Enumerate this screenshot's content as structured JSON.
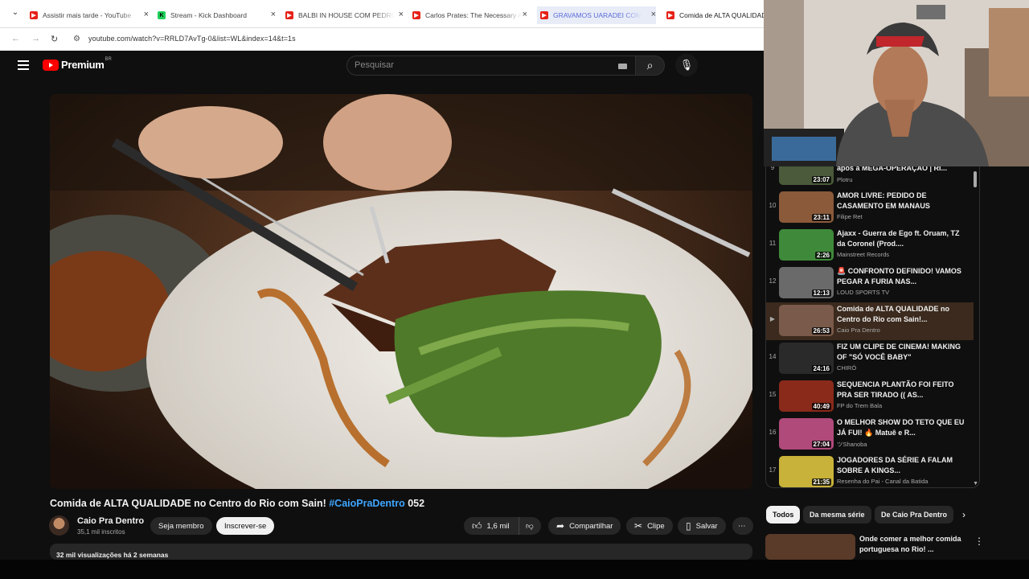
{
  "tabs": [
    {
      "title": "Assistir mais tarde - YouTube",
      "fav": "yt"
    },
    {
      "title": "Stream - Kick Dashboard",
      "fav": "kick"
    },
    {
      "title": "BALBI IN HOUSE COM PEDRO",
      "fav": "yt"
    },
    {
      "title": "Carlos Prates: The Necessary A",
      "fav": "yt"
    },
    {
      "title": "GRAVAMOS UARADEI COM OA",
      "fav": "yt"
    },
    {
      "title": "Comida de ALTA QUALIDADE",
      "fav": "yt"
    }
  ],
  "address": {
    "url": "youtube.com/watch?v=RRLD7AvTg-0&list=WL&index=14&t=1s"
  },
  "header": {
    "logo": "Premium",
    "logo_region": "BR",
    "search_placeholder": "Pesquisar"
  },
  "video": {
    "title": "Comida de ALTA QUALIDADE no Centro do Rio com Sain!",
    "hashtag": "#CaioPraDentro",
    "number": "052",
    "channel": "Caio Pra Dentro",
    "subs": "35,1 mil inscritos",
    "join": "Seja membro",
    "subscribe": "Inscrever-se",
    "likes": "1,6 mil",
    "share": "Compartilhar",
    "clip": "Clipe",
    "save": "Salvar",
    "views": "32 mil visualizações  há 2 semanas"
  },
  "playlist": [
    {
      "num": "9",
      "title": "após a MEGA-OPERAÇÃO | RI...",
      "channel": "Plotru",
      "dur": "23:07"
    },
    {
      "num": "10",
      "title": "AMOR LIVRE: PEDIDO DE CASAMENTO EM MANAUS",
      "channel": "Filipe Ret",
      "dur": "23:11"
    },
    {
      "num": "11",
      "title": "Ajaxx - Guerra de Ego ft. Oruam, TZ da Coronel (Prod....",
      "channel": "Mainstreet Records",
      "dur": "2:26"
    },
    {
      "num": "12",
      "title": "🚨 CONFRONTO DEFINIDO! VAMOS PEGAR A FURIA NAS...",
      "channel": "LOUD SPORTS TV",
      "dur": "12:13"
    },
    {
      "num": "▶",
      "title": "Comida de ALTA QUALIDADE no Centro do Rio com Sain!...",
      "channel": "Caio Pra Dentro",
      "dur": "26:53"
    },
    {
      "num": "14",
      "title": "FIZ UM CLIPE DE CINEMA! MAKING OF \"SÓ VOCÊ BABY\"",
      "channel": "CHIRÓ",
      "dur": "24:16"
    },
    {
      "num": "15",
      "title": "SEQUENCIA PLANTÃO FOI FEITO PRA SER TIRADO (( AS...",
      "channel": "FP do Trem Bala",
      "dur": "40:49"
    },
    {
      "num": "16",
      "title": "O MELHOR SHOW DO TETO QUE EU JÁ FUI! 🔥 Matuê e R...",
      "channel": "ツShanoba",
      "dur": "27:04"
    },
    {
      "num": "17",
      "title": "JOGADORES DA SÉRIE A FALAM SOBRE A KINGS...",
      "channel": "Resenha do Pai - Canal da Batida",
      "dur": "21:35"
    }
  ],
  "chips": [
    "Todos",
    "Da mesma série",
    "De Caio Pra Dentro"
  ],
  "recommendation": {
    "title": "Onde comer a melhor comida portuguesa no Rio! ..."
  }
}
